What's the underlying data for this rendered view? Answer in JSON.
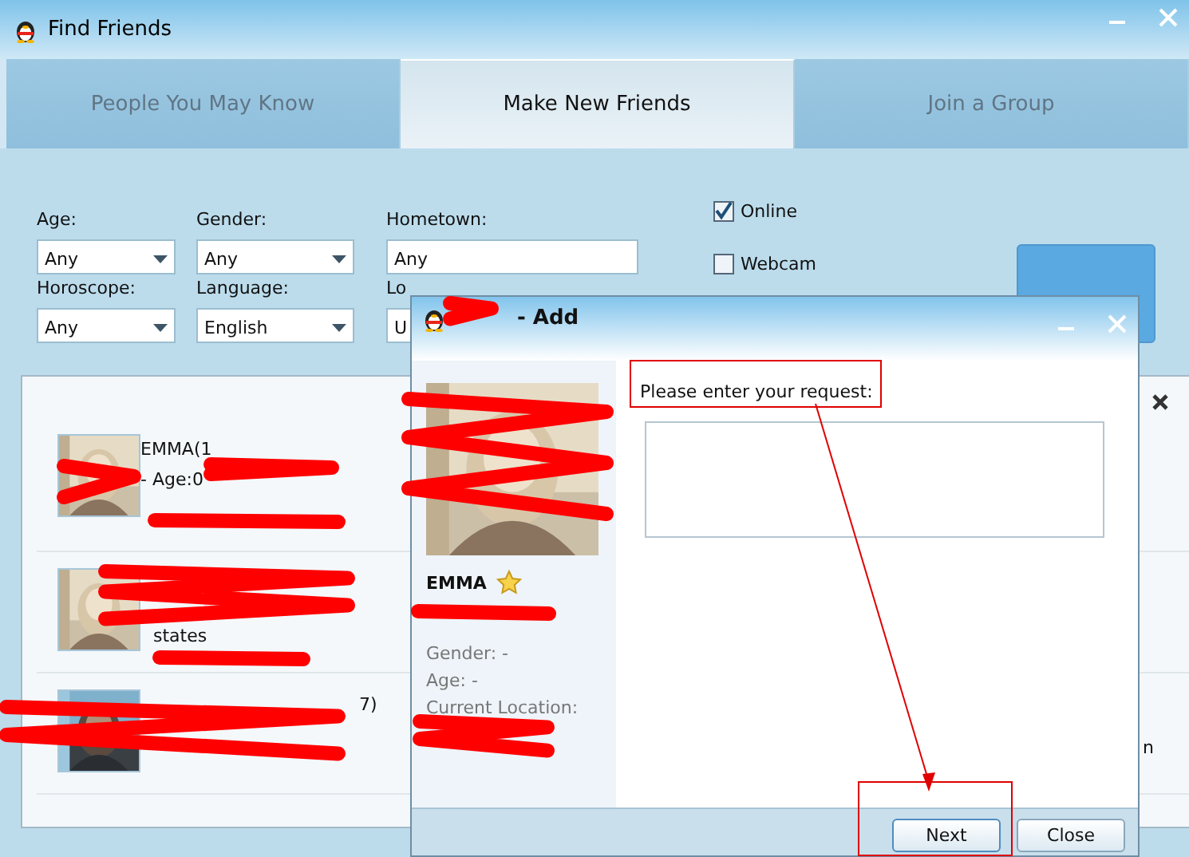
{
  "window": {
    "title": "Find Friends"
  },
  "tabs": [
    {
      "label": "People You May Know",
      "selected": false
    },
    {
      "label": "Make New Friends",
      "selected": true
    },
    {
      "label": "Join a Group",
      "selected": false
    }
  ],
  "filters": [
    {
      "kind": "dropdown",
      "label": "Age:",
      "value": "Any"
    },
    {
      "kind": "dropdown",
      "label": "Gender:",
      "value": "Any"
    },
    {
      "kind": "text",
      "label": "Hometown:",
      "value": "Any"
    },
    {
      "kind": "dropdown",
      "label": "Horoscope:",
      "value": "Any"
    },
    {
      "kind": "dropdown",
      "label": "Language:",
      "value": "English"
    },
    {
      "kind": "text",
      "label": "Lo",
      "value": "U"
    }
  ],
  "checkboxes": [
    {
      "label": "Online",
      "checked": true
    },
    {
      "label": "Webcam",
      "checked": false
    }
  ],
  "results": {
    "rows": [
      {
        "lines": [
          "EMMA(1",
          "- Age:0"
        ]
      },
      {
        "lines": [
          "states"
        ]
      },
      {
        "lines": [
          "7)"
        ]
      }
    ],
    "side_text": "n"
  },
  "dialog": {
    "title": "- Add",
    "name": "EMMA",
    "details": [
      "Gender: -",
      "Age: -",
      "Current Location:"
    ],
    "prompt": "Please enter your request:",
    "buttons": [
      "Next",
      "Close"
    ]
  }
}
